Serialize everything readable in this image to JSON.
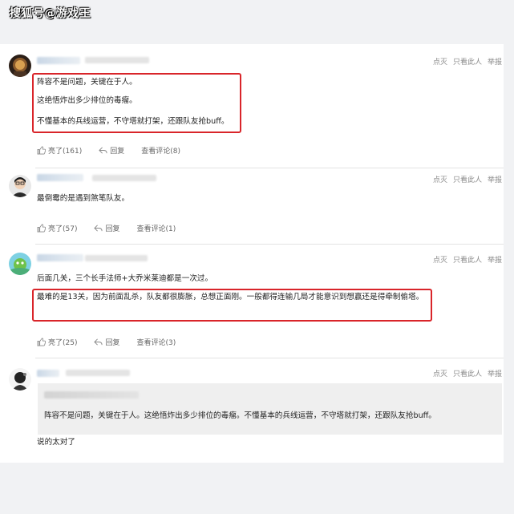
{
  "watermark": "搜狐号@游戏王",
  "actions": {
    "like": "点灭",
    "only_this": "只看此人",
    "report": "举报"
  },
  "comments": [
    {
      "lines": [
        "阵容不是问题，关键在于人。",
        "这绝悟炸出多少排位的毒瘤。",
        "不懂基本的兵线运营，不守塔就打架，还跟队友抢buff。"
      ],
      "like_label": "亮了(161)",
      "reply_label": "回复",
      "view_label": "查看评论(8)"
    },
    {
      "lines": [
        "最倒霉的是遇到煞笔队友。"
      ],
      "like_label": "亮了(57)",
      "reply_label": "回复",
      "view_label": "查看评论(1)"
    },
    {
      "lines": [
        "后面几关，三个长手法师+大乔米莱迪都是一次过。"
      ],
      "highlight_text": "最难的是13关，因为前面乱杀，队友都很膨胀，总想正面刚。一般都得连输几局才能意识到想赢还是得牵制偷塔。",
      "like_label": "亮了(25)",
      "reply_label": "回复",
      "view_label": "查看评论(3)"
    },
    {
      "quote_text": "阵容不是问题，关键在于人。这绝悟炸出多少排位的毒瘤。不懂基本的兵线运营，不守塔就打架，还跟队友抢buff。",
      "reply_text": "说的太对了"
    }
  ]
}
